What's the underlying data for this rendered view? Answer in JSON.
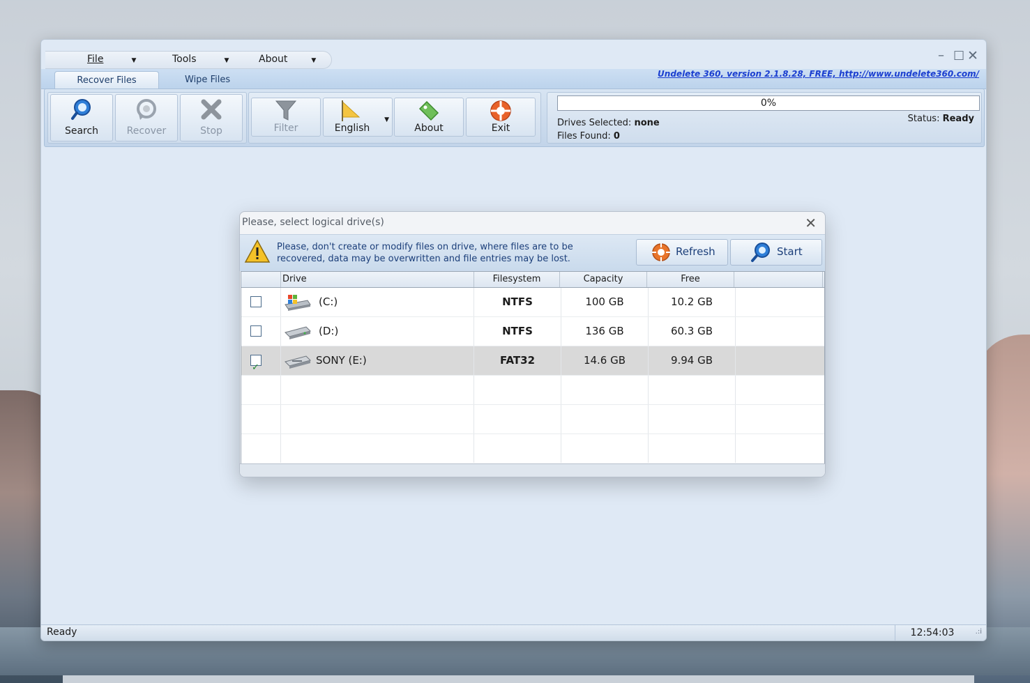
{
  "menu": {
    "file": "File",
    "tools": "Tools",
    "about": "About"
  },
  "window_controls": {
    "minimize": "–",
    "maximize": "□",
    "close": "✕"
  },
  "tabs": [
    {
      "label": "Recover Files",
      "active": true
    },
    {
      "label": "Wipe Files",
      "active": false
    }
  ],
  "version_link": "Undelete 360, version 2.1.8.28, FREE, http://www.undelete360.com/",
  "toolbar": {
    "search": "Search",
    "recover": "Recover",
    "stop": "Stop",
    "filter": "Filter",
    "english": "English",
    "about": "About",
    "exit": "Exit"
  },
  "progress": {
    "percent_text": "0%",
    "drives_selected_label": "Drives Selected:",
    "drives_selected_value": "none",
    "files_found_label": "Files Found:",
    "files_found_value": "0",
    "status_label": "Status:",
    "status_value": "Ready"
  },
  "dialog": {
    "title": "Please, select logical drive(s)",
    "close": "✕",
    "warning_line1": "Please, don't create or modify files on drive, where files are to be",
    "warning_line2": "recovered, data may be overwritten and file entries may be lost.",
    "refresh": "Refresh",
    "start": "Start",
    "columns": [
      "Drive",
      "Filesystem",
      "Capacity",
      "Free"
    ],
    "drives": [
      {
        "name": "(C:)",
        "filesystem": "NTFS",
        "capacity": "100 GB",
        "free": "10.2 GB",
        "checked": false,
        "icon": "windows-drive-icon"
      },
      {
        "name": "(D:)",
        "filesystem": "NTFS",
        "capacity": "136 GB",
        "free": "60.3 GB",
        "checked": false,
        "icon": "hard-drive-icon"
      },
      {
        "name": "SONY (E:)",
        "filesystem": "FAT32",
        "capacity": "14.6 GB",
        "free": "9.94 GB",
        "checked": true,
        "icon": "removable-drive-icon"
      }
    ]
  },
  "statusbar": {
    "left": "Ready",
    "clock": "12:54:03",
    "grip": ".:i"
  },
  "colors": {
    "accent": "#1c3f7a",
    "link": "#1b3fd0",
    "selected_row": "#d9d9d9",
    "window_bg": "#dfe9f5"
  }
}
